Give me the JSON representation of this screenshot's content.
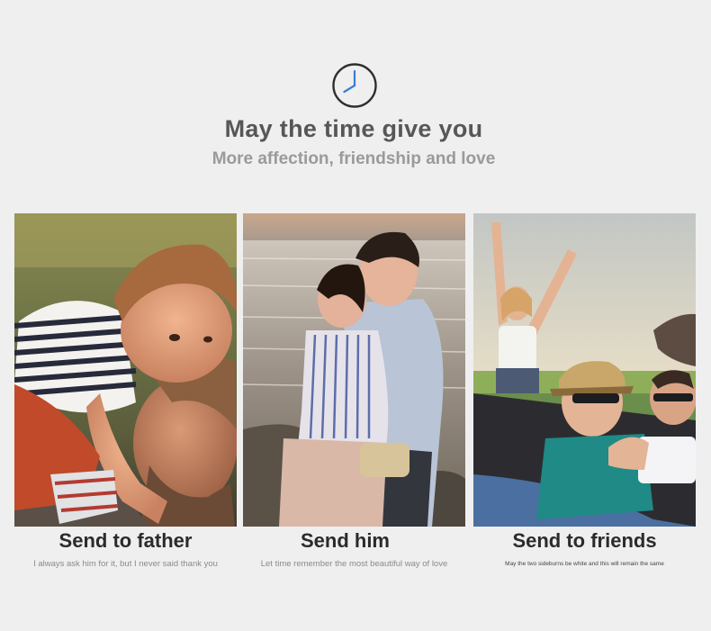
{
  "header": {
    "clock_icon": "clock-icon",
    "title": "May the time give you",
    "subtitle": "More affection, friendship and love"
  },
  "cards": [
    {
      "title": "Send to father",
      "caption": "I always ask him for it, but I never said thank you",
      "image": "father-with-child-photo"
    },
    {
      "title": "Send him",
      "caption": "Let time remember the most beautiful way of love",
      "image": "couple-by-sea-photo"
    },
    {
      "title": "Send to friends",
      "caption": "May the two sideburns be white and this will remain the same",
      "image": "friends-in-convertible-photo"
    }
  ],
  "colors": {
    "background": "#efefef",
    "title": "#575757",
    "subtitle": "#9a9a9a",
    "card_title": "#2b2b2b",
    "clock_hand": "#3d7bd6"
  }
}
